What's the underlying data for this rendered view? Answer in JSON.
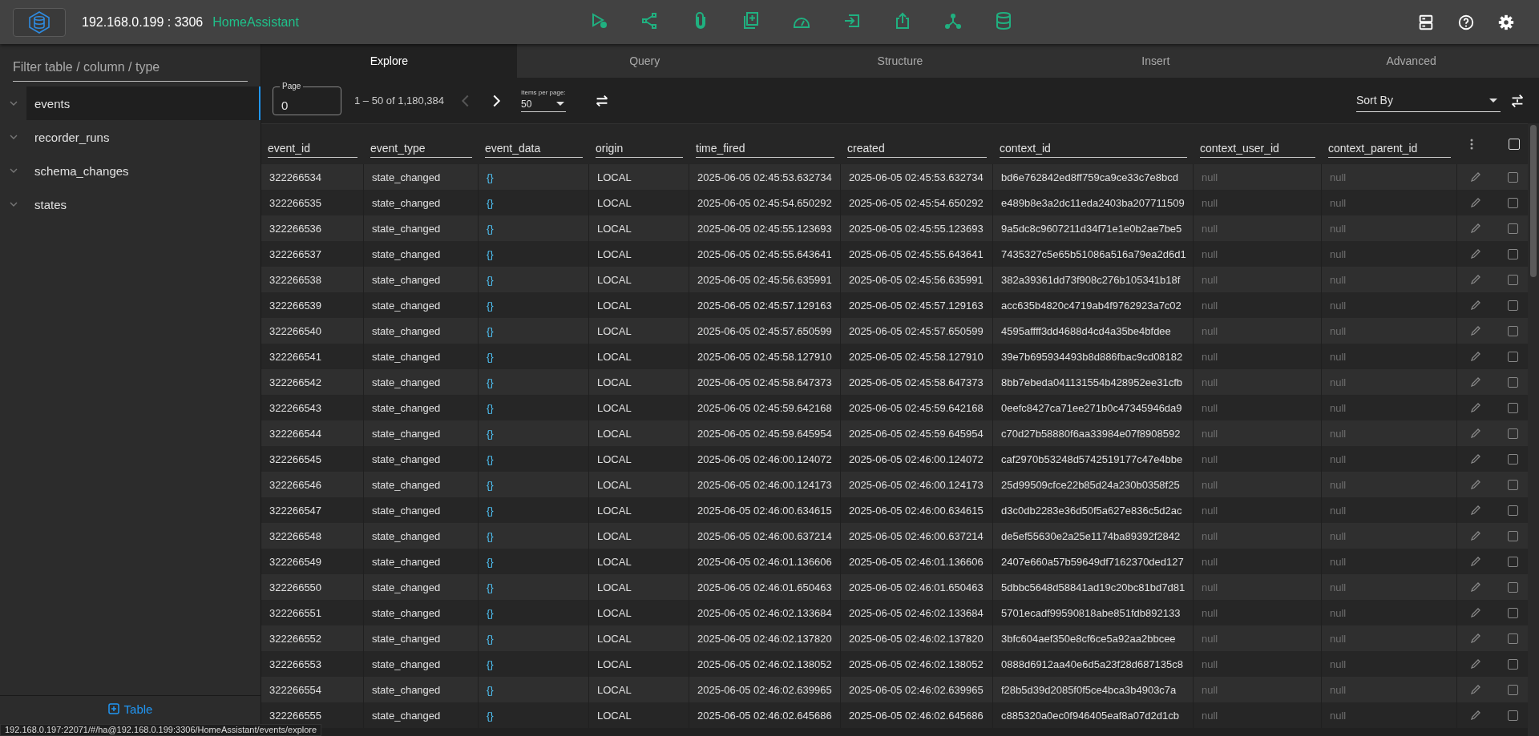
{
  "header": {
    "host": "192.168.0.199 : 3306",
    "database": "HomeAssistant"
  },
  "sidebar": {
    "filter_placeholder": "Filter table / column / type",
    "tables": [
      {
        "name": "events",
        "selected": true
      },
      {
        "name": "recorder_runs",
        "selected": false
      },
      {
        "name": "schema_changes",
        "selected": false
      },
      {
        "name": "states",
        "selected": false
      }
    ],
    "add_button": "Table"
  },
  "tabs": [
    {
      "label": "Explore",
      "selected": true
    },
    {
      "label": "Query",
      "selected": false
    },
    {
      "label": "Structure",
      "selected": false
    },
    {
      "label": "Insert",
      "selected": false
    },
    {
      "label": "Advanced",
      "selected": false
    }
  ],
  "pagination": {
    "page_label": "Page",
    "page": "0",
    "range": "1 – 50 of 1,180,384",
    "prev_disabled": true,
    "next_disabled": false,
    "items_label": "Items per page:",
    "items": "50"
  },
  "sort": {
    "placeholder": "Sort By"
  },
  "columns": [
    {
      "name": "event_id",
      "kind": "text"
    },
    {
      "name": "event_type",
      "kind": "text"
    },
    {
      "name": "event_data",
      "kind": "json"
    },
    {
      "name": "origin",
      "kind": "text"
    },
    {
      "name": "time_fired",
      "kind": "text"
    },
    {
      "name": "created",
      "kind": "text"
    },
    {
      "name": "context_id",
      "kind": "text"
    },
    {
      "name": "context_user_id",
      "kind": "null"
    },
    {
      "name": "context_parent_id",
      "kind": "null"
    }
  ],
  "header_checked": false,
  "rows": [
    {
      "checked": false,
      "cells": [
        "322266534",
        "state_changed",
        "{}",
        "LOCAL",
        "2025-06-05 02:45:53.632734",
        "2025-06-05 02:45:53.632734",
        "bd6e762842ed8ff759ca9ce33c7e8bcd",
        "null",
        "null"
      ]
    },
    {
      "checked": false,
      "cells": [
        "322266535",
        "state_changed",
        "{}",
        "LOCAL",
        "2025-06-05 02:45:54.650292",
        "2025-06-05 02:45:54.650292",
        "e489b8e3a2dc11eda2403ba207711509",
        "null",
        "null"
      ]
    },
    {
      "checked": false,
      "cells": [
        "322266536",
        "state_changed",
        "{}",
        "LOCAL",
        "2025-06-05 02:45:55.123693",
        "2025-06-05 02:45:55.123693",
        "9a5dc8c9607211d34f71e1e0b2ae7be5",
        "null",
        "null"
      ]
    },
    {
      "checked": false,
      "cells": [
        "322266537",
        "state_changed",
        "{}",
        "LOCAL",
        "2025-06-05 02:45:55.643641",
        "2025-06-05 02:45:55.643641",
        "7435327c5e65b51086a516a79ea2d6d1",
        "null",
        "null"
      ]
    },
    {
      "checked": false,
      "cells": [
        "322266538",
        "state_changed",
        "{}",
        "LOCAL",
        "2025-06-05 02:45:56.635991",
        "2025-06-05 02:45:56.635991",
        "382a39361dd73f908c276b105341b18f",
        "null",
        "null"
      ]
    },
    {
      "checked": false,
      "cells": [
        "322266539",
        "state_changed",
        "{}",
        "LOCAL",
        "2025-06-05 02:45:57.129163",
        "2025-06-05 02:45:57.129163",
        "acc635b4820c4719ab4f9762923a7c02",
        "null",
        "null"
      ]
    },
    {
      "checked": false,
      "cells": [
        "322266540",
        "state_changed",
        "{}",
        "LOCAL",
        "2025-06-05 02:45:57.650599",
        "2025-06-05 02:45:57.650599",
        "4595affff3dd4688d4cd4a35be4bfdee",
        "null",
        "null"
      ]
    },
    {
      "checked": false,
      "cells": [
        "322266541",
        "state_changed",
        "{}",
        "LOCAL",
        "2025-06-05 02:45:58.127910",
        "2025-06-05 02:45:58.127910",
        "39e7b695934493b8d886fbac9cd08182",
        "null",
        "null"
      ]
    },
    {
      "checked": false,
      "cells": [
        "322266542",
        "state_changed",
        "{}",
        "LOCAL",
        "2025-06-05 02:45:58.647373",
        "2025-06-05 02:45:58.647373",
        "8bb7ebeda041131554b428952ee31cfb",
        "null",
        "null"
      ]
    },
    {
      "checked": false,
      "cells": [
        "322266543",
        "state_changed",
        "{}",
        "LOCAL",
        "2025-06-05 02:45:59.642168",
        "2025-06-05 02:45:59.642168",
        "0eefc8427ca71ee271b0c47345946da9",
        "null",
        "null"
      ]
    },
    {
      "checked": false,
      "cells": [
        "322266544",
        "state_changed",
        "{}",
        "LOCAL",
        "2025-06-05 02:45:59.645954",
        "2025-06-05 02:45:59.645954",
        "c70d27b58880f6aa33984e07f8908592",
        "null",
        "null"
      ]
    },
    {
      "checked": false,
      "cells": [
        "322266545",
        "state_changed",
        "{}",
        "LOCAL",
        "2025-06-05 02:46:00.124072",
        "2025-06-05 02:46:00.124072",
        "caf2970b53248d5742519177c47e4bbe",
        "null",
        "null"
      ]
    },
    {
      "checked": false,
      "cells": [
        "322266546",
        "state_changed",
        "{}",
        "LOCAL",
        "2025-06-05 02:46:00.124173",
        "2025-06-05 02:46:00.124173",
        "25d99509cfce22b85d24a230b0358f25",
        "null",
        "null"
      ]
    },
    {
      "checked": false,
      "cells": [
        "322266547",
        "state_changed",
        "{}",
        "LOCAL",
        "2025-06-05 02:46:00.634615",
        "2025-06-05 02:46:00.634615",
        "d3c0db2283e36d50f5a627e836c5d2ac",
        "null",
        "null"
      ]
    },
    {
      "checked": false,
      "cells": [
        "322266548",
        "state_changed",
        "{}",
        "LOCAL",
        "2025-06-05 02:46:00.637214",
        "2025-06-05 02:46:00.637214",
        "de5ef55630e2a25e1174ba89392f2842",
        "null",
        "null"
      ]
    },
    {
      "checked": false,
      "cells": [
        "322266549",
        "state_changed",
        "{}",
        "LOCAL",
        "2025-06-05 02:46:01.136606",
        "2025-06-05 02:46:01.136606",
        "2407e660a57b59649df7162370ded127",
        "null",
        "null"
      ]
    },
    {
      "checked": false,
      "cells": [
        "322266550",
        "state_changed",
        "{}",
        "LOCAL",
        "2025-06-05 02:46:01.650463",
        "2025-06-05 02:46:01.650463",
        "5dbbc5648d58841ad19c20bc81bd7d81",
        "null",
        "null"
      ]
    },
    {
      "checked": false,
      "cells": [
        "322266551",
        "state_changed",
        "{}",
        "LOCAL",
        "2025-06-05 02:46:02.133684",
        "2025-06-05 02:46:02.133684",
        "5701ecadf99590818abe851fdb892133",
        "null",
        "null"
      ]
    },
    {
      "checked": false,
      "cells": [
        "322266552",
        "state_changed",
        "{}",
        "LOCAL",
        "2025-06-05 02:46:02.137820",
        "2025-06-05 02:46:02.137820",
        "3bfc604aef350e8cf6ce5a92aa2bbcee",
        "null",
        "null"
      ]
    },
    {
      "checked": false,
      "cells": [
        "322266553",
        "state_changed",
        "{}",
        "LOCAL",
        "2025-06-05 02:46:02.138052",
        "2025-06-05 02:46:02.138052",
        "0888d6912aa40e6d5a23f28d687135c8",
        "null",
        "null"
      ]
    },
    {
      "checked": false,
      "cells": [
        "322266554",
        "state_changed",
        "{}",
        "LOCAL",
        "2025-06-05 02:46:02.639965",
        "2025-06-05 02:46:02.639965",
        "f28b5d39d2085f0f5ce4bca3b4903c7a",
        "null",
        "null"
      ]
    },
    {
      "checked": false,
      "cells": [
        "322266555",
        "state_changed",
        "{}",
        "LOCAL",
        "2025-06-05 02:46:02.645686",
        "2025-06-05 02:46:02.645686",
        "c885320a0ec0f946405eaf8a07d2d1cb",
        "null",
        "null"
      ]
    }
  ],
  "status_url": "192.168.0.197:22071/#/ha@192.168.0.199:3306/HomeAssistant/events/explore"
}
